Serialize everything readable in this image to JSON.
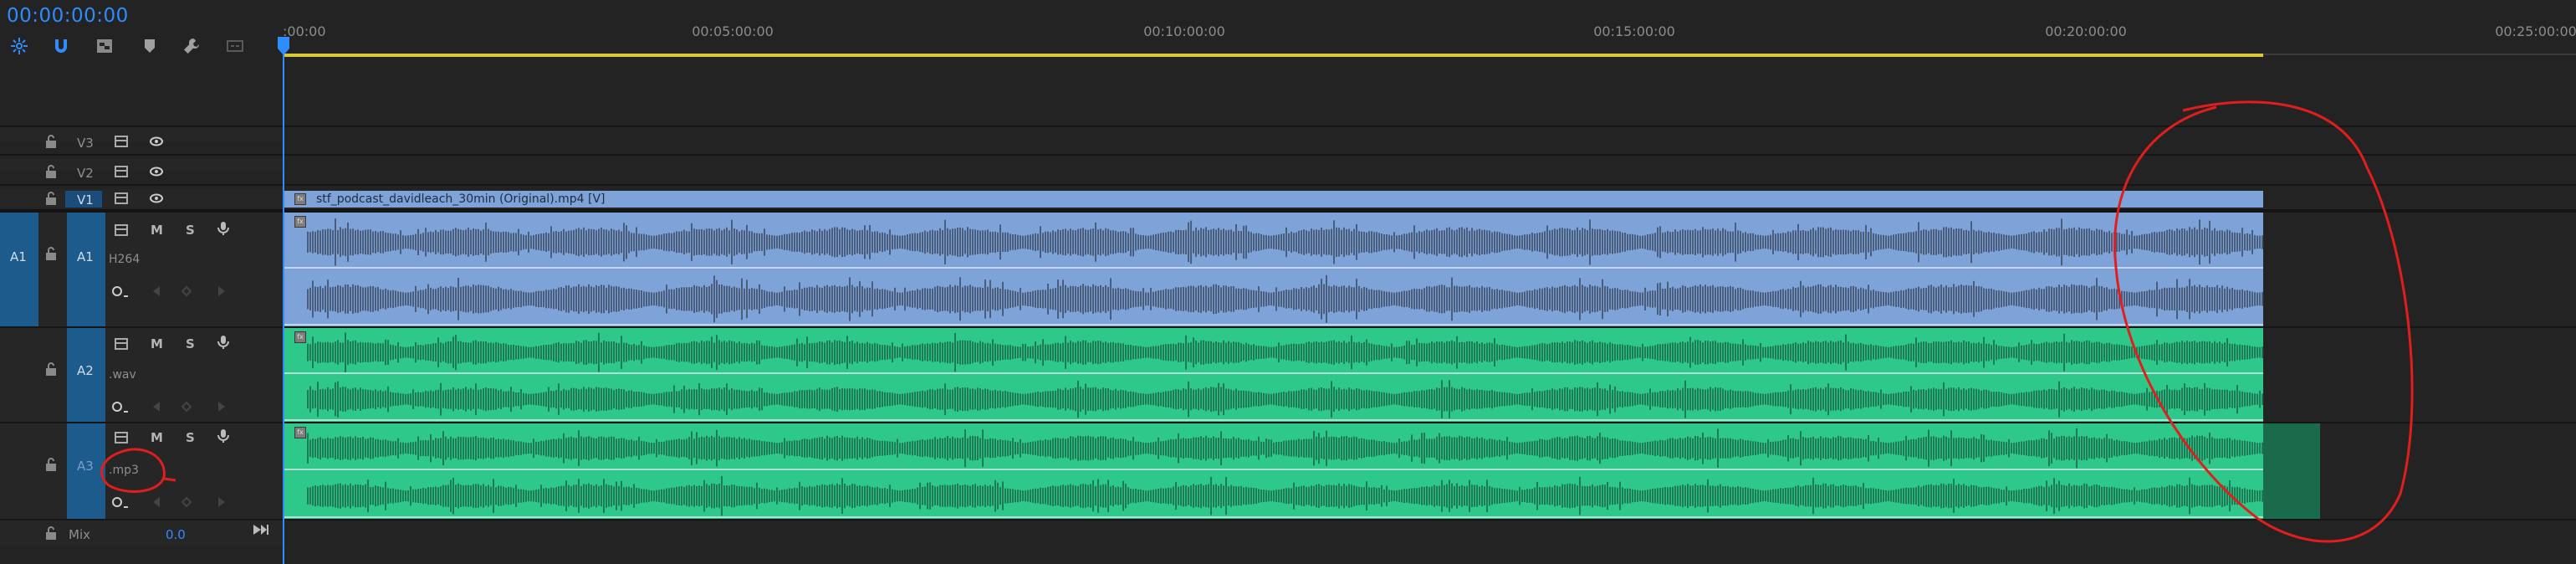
{
  "header": {
    "timecode": "00:00:00:00",
    "tools": [
      {
        "icon": "ripple-edit-icon"
      },
      {
        "icon": "snap-magnet-icon"
      },
      {
        "icon": "linked-selection-icon"
      },
      {
        "icon": "add-marker-icon"
      },
      {
        "icon": "wrench-settings-icon"
      },
      {
        "icon": "captions-icon"
      }
    ]
  },
  "ruler": {
    "ticks": [
      {
        "label": ":00:00"
      },
      {
        "label": "00:05:00:00"
      },
      {
        "label": "00:10:00:00"
      },
      {
        "label": "00:15:00:00"
      },
      {
        "label": "00:20:00:00"
      },
      {
        "label": "00:25:00:00"
      }
    ]
  },
  "tracks": {
    "v3": {
      "label": "V3"
    },
    "v2": {
      "label": "V2"
    },
    "v1": {
      "label": "V1"
    },
    "a1": {
      "source": "A1",
      "label": "A1",
      "clip_label": "H264",
      "mute": "M",
      "solo": "S"
    },
    "a2": {
      "label": "A2",
      "clip_label": ".wav",
      "mute": "M",
      "solo": "S"
    },
    "a3": {
      "label": "A3",
      "clip_label": ".mp3",
      "mute": "M",
      "solo": "S"
    },
    "mix": {
      "label": "Mix",
      "value": "0.0"
    }
  },
  "clips": {
    "video_name": "stf_podcast_davidleach_30min (Original).mp4 [V]",
    "fx": "fx"
  },
  "colors": {
    "accent": "#2f8cff",
    "video_clip": "#7ea3d9",
    "audio_green": "#2ec88a",
    "annotation_red": "#e01e1e"
  }
}
